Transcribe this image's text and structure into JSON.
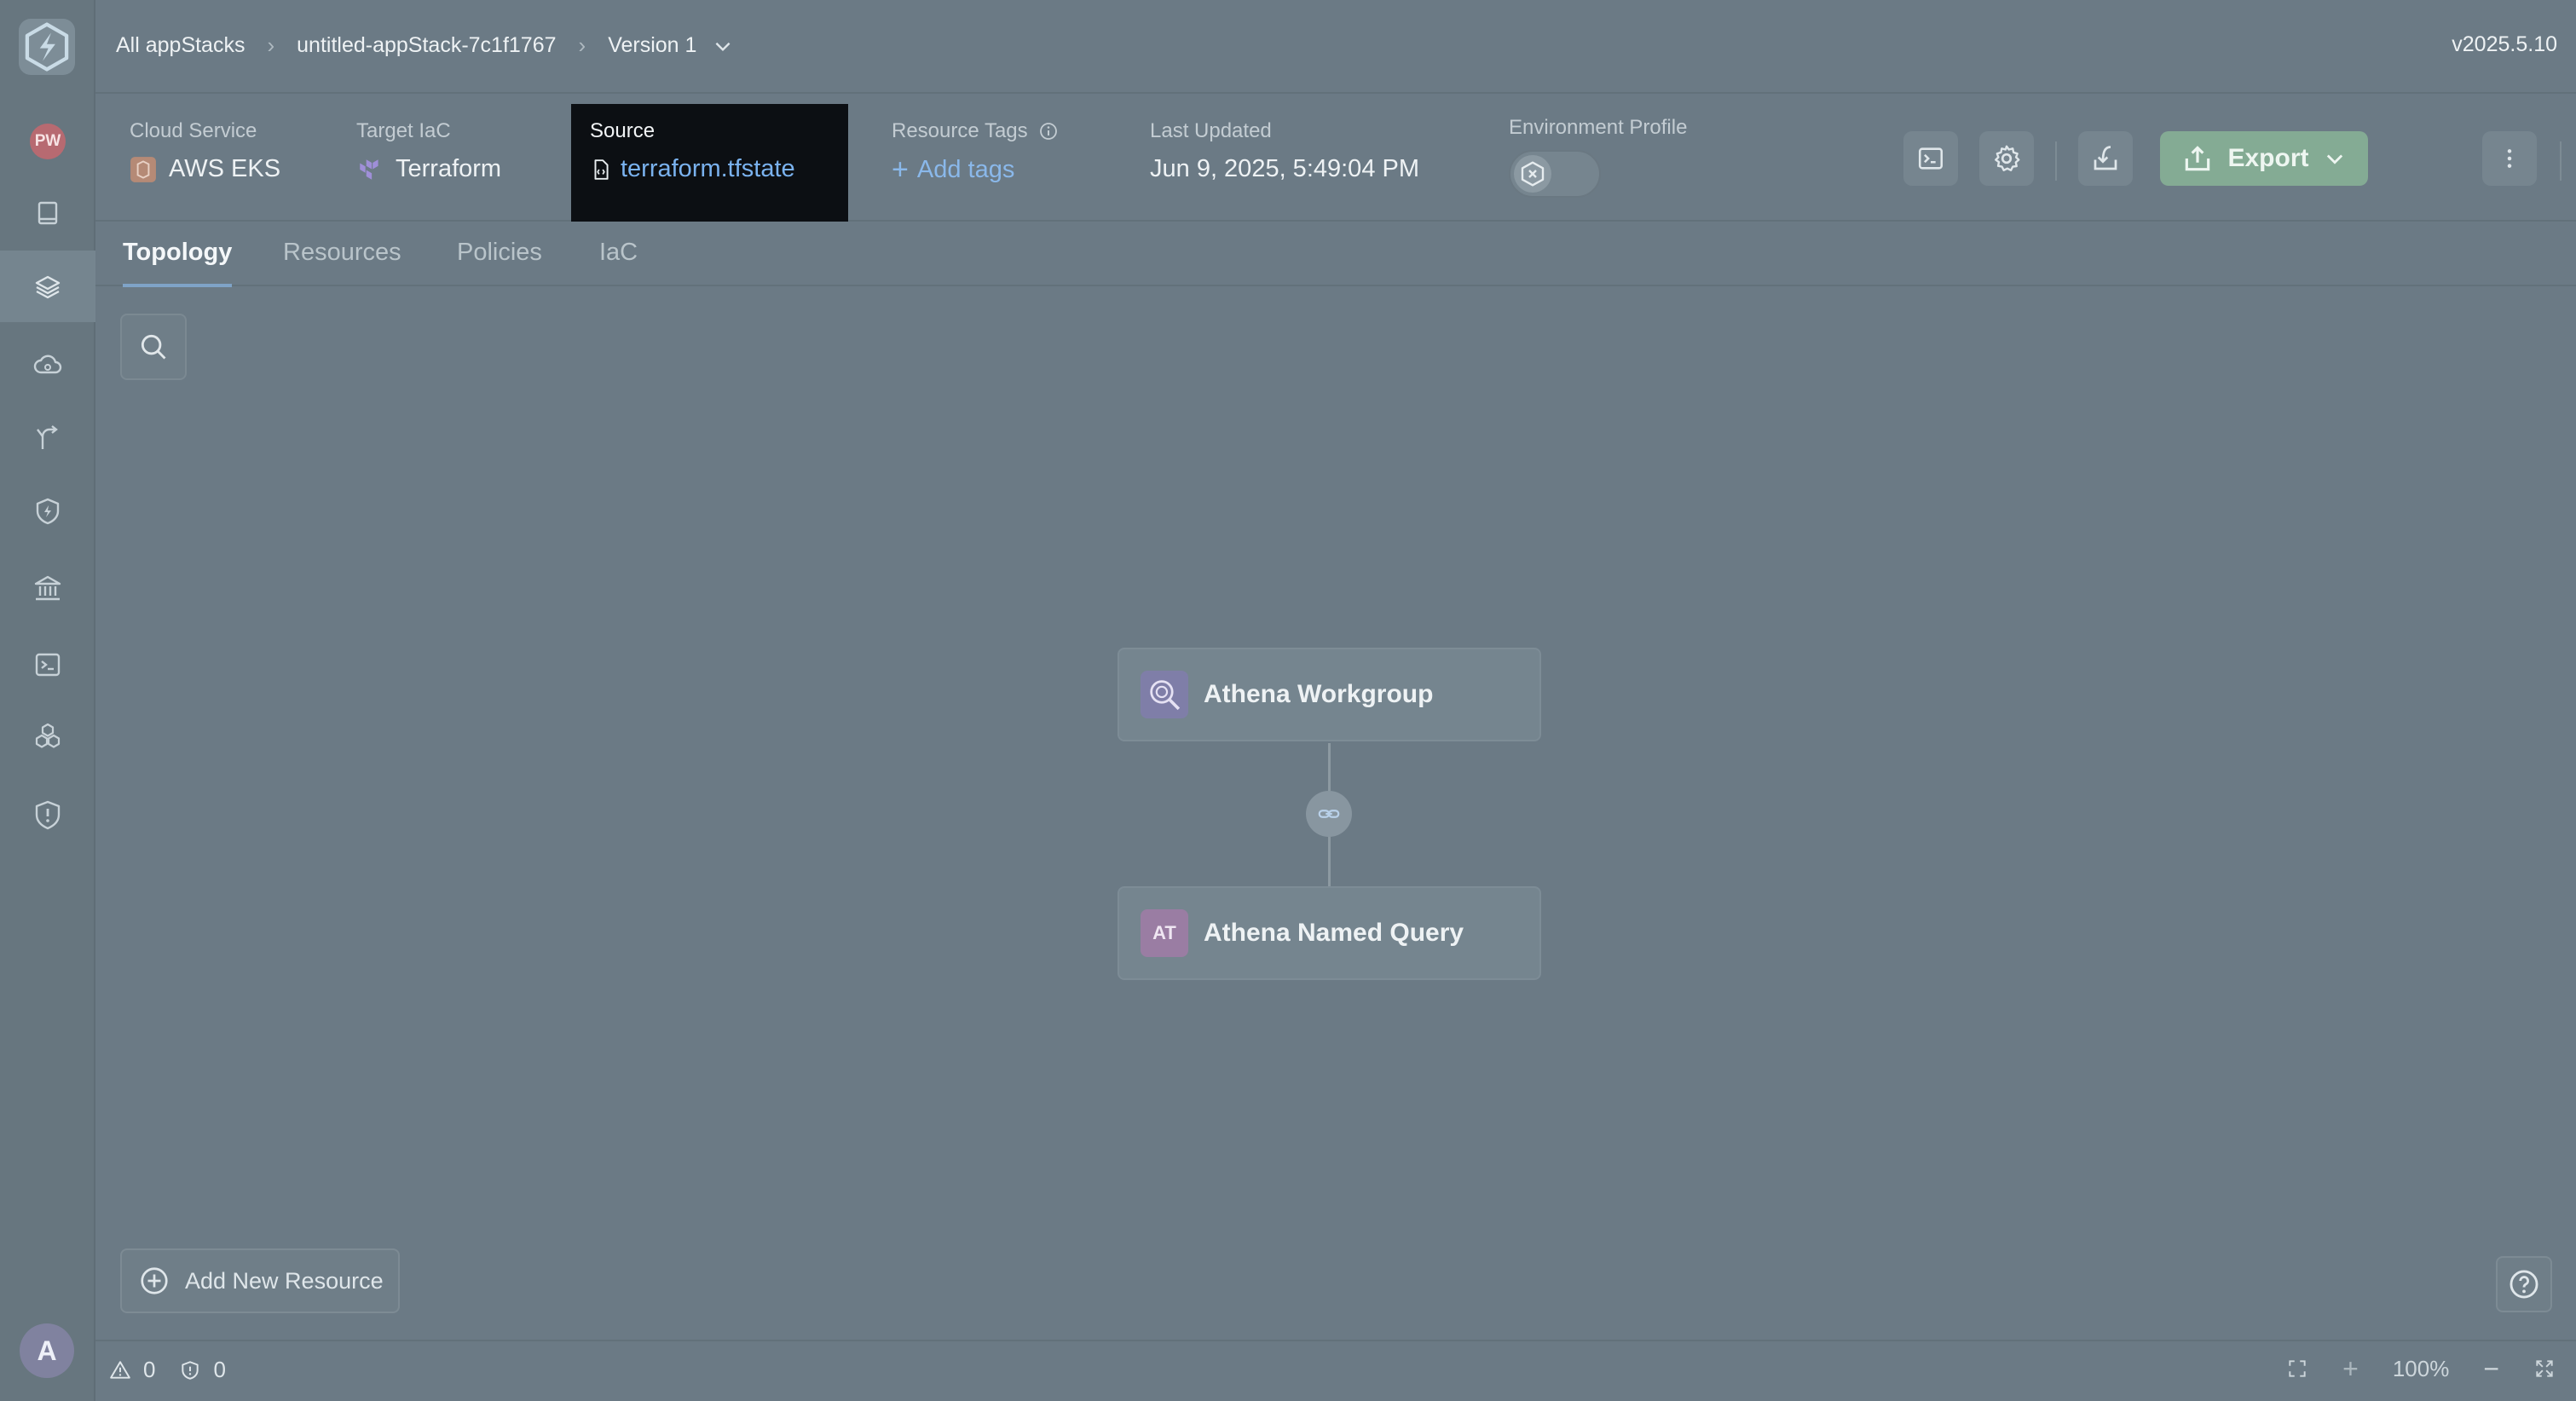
{
  "breadcrumbs": {
    "all": "All appStacks",
    "stack": "untitled-appStack-7c1f1767",
    "version": "Version 1"
  },
  "app_version": "v2025.5.10",
  "info": {
    "cloud_service_label": "Cloud Service",
    "cloud_service_value": "AWS EKS",
    "target_iac_label": "Target IaC",
    "target_iac_value": "Terraform",
    "source_label": "Source",
    "source_value": "terraform.tfstate",
    "tags_label": "Resource Tags",
    "tags_action": "Add tags",
    "updated_label": "Last Updated",
    "updated_value": "Jun 9, 2025, 5:49:04 PM",
    "env_label": "Environment Profile"
  },
  "toolbar": {
    "export_label": "Export"
  },
  "tabs": [
    "Topology",
    "Resources",
    "Policies",
    "IaC"
  ],
  "nodes": [
    {
      "label": "Athena Workgroup",
      "icon": "magnifier-icon"
    },
    {
      "label": "Athena Named Query",
      "badge": "AT"
    }
  ],
  "canvas": {
    "add_resource": "Add New Resource"
  },
  "sidebar": {
    "workspace_badge": "PW",
    "user_initial": "A"
  },
  "status": {
    "warnings": "0",
    "errors": "0",
    "zoom": "100%"
  },
  "colors": {
    "accent_link": "#8ab8ea",
    "export_green": "#84ab94",
    "background": "#6b7a85"
  }
}
